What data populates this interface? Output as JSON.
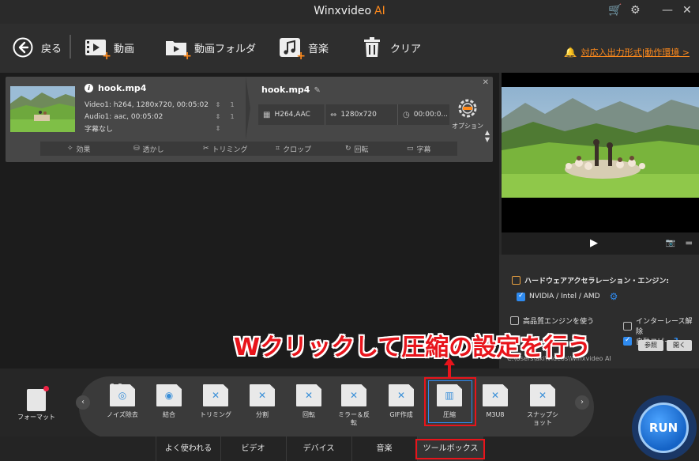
{
  "app": {
    "title": "Winxvideo",
    "title_ai": "AI",
    "colors": {
      "accent": "#ff8a1c",
      "highlight": "#e8141b",
      "blue": "#2f8bf0"
    }
  },
  "toolbar": {
    "back_label": "戻る",
    "video_label": "動画",
    "folder_label": "動画フォルダ",
    "music_label": "音楽",
    "clear_label": "クリア",
    "support_link": "対応入出力形式|動作環境 >"
  },
  "file": {
    "name": "hook.mp4",
    "video_info": "Video1: h264, 1280x720, 00:05:02",
    "audio_info": "Audio1: aac, 00:05:02",
    "subtitle_info": "字幕なし",
    "out_name": "hook.mp4",
    "out_codec": "H264,AAC",
    "out_resolution": "1280x720",
    "out_duration": "00:00:0...",
    "option_label": "オプション",
    "edit_tools": [
      "効果",
      "透かし",
      "トリミング",
      "クロップ",
      "回転",
      "字幕"
    ]
  },
  "settings": {
    "hw_engine_label": "ハードウェアアクセラレーション・エンジン:",
    "hw_vendor_label": "NVIDIA / Intel / AMD",
    "hq_engine_label": "高品質エンジンを使う",
    "deinterlace_label": "インターレース解除",
    "merge_label": "結合",
    "autocopy_label": "自動コピー",
    "browse_label": "参照",
    "open_label": "開く",
    "output_path": "C:\\Users\\aki\\Videos\\Winxvideo AI"
  },
  "bottom": {
    "format_label": "フォーマット",
    "gopro_label": "GoPro",
    "tools": [
      {
        "label": "ノイズ除去"
      },
      {
        "label": "結合"
      },
      {
        "label": "トリミング"
      },
      {
        "label": "分割"
      },
      {
        "label": "回転"
      },
      {
        "label": "ミラー＆反転"
      },
      {
        "label": "GIF作成"
      },
      {
        "label": "圧縮"
      },
      {
        "label": "M3U8"
      },
      {
        "label": "スナップショット"
      }
    ],
    "tabs": [
      "よく使われる",
      "ビデオ",
      "デバイス",
      "音楽",
      "ツールボックス"
    ],
    "run_label": "RUN"
  },
  "annotation": {
    "text": "Wクリックして圧縮の設定を行う"
  }
}
